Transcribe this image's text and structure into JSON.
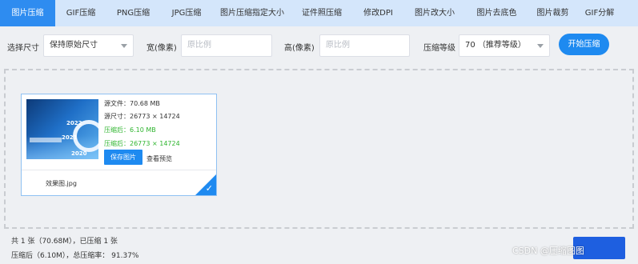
{
  "tabs": [
    {
      "label": "图片压缩",
      "active": true
    },
    {
      "label": "GIF压缩",
      "active": false
    },
    {
      "label": "PNG压缩",
      "active": false
    },
    {
      "label": "JPG压缩",
      "active": false
    },
    {
      "label": "图片压缩指定大小",
      "active": false
    },
    {
      "label": "证件照压缩",
      "active": false
    },
    {
      "label": "修改DPI",
      "active": false
    },
    {
      "label": "图片改大小",
      "active": false
    },
    {
      "label": "图片去底色",
      "active": false
    },
    {
      "label": "图片裁剪",
      "active": false
    },
    {
      "label": "GIF分解",
      "active": false
    }
  ],
  "toolbar": {
    "size_label": "选择尺寸",
    "size_value": "保持原始尺寸",
    "width_label": "宽(像素)",
    "width_placeholder": "原比例",
    "height_label": "高(像素)",
    "height_placeholder": "原比例",
    "level_label": "压缩等级",
    "level_value": "70  （推荐等级）",
    "start_button": "开始压缩"
  },
  "card": {
    "thumbnail_years": [
      "2022",
      "2021",
      "2020"
    ],
    "source_file_label": "源文件",
    "source_file_value": "70.68 MB",
    "source_size_label": "源尺寸",
    "source_size_value": "26773 × 14724",
    "compressed_label": "压缩后",
    "compressed_value": "6.10 MB",
    "compressed_size_label": "压缩后",
    "compressed_size_value": "26773 × 14724",
    "save_button": "保存图片",
    "preview_link": "查看预览",
    "filename": "效果图.jpg",
    "check_icon": "checkmark-icon"
  },
  "footer": {
    "summary_line1": "共 1 张（70.68M），已压缩 1 张",
    "summary_line2": "压缩后（6.10M），总压缩率： 91.37%",
    "watermark": "CSDN @压缩图图"
  },
  "colors": {
    "accent": "#1e8af0",
    "tab_bar": "#d4e6fb",
    "success_green": "#2fb52f"
  }
}
